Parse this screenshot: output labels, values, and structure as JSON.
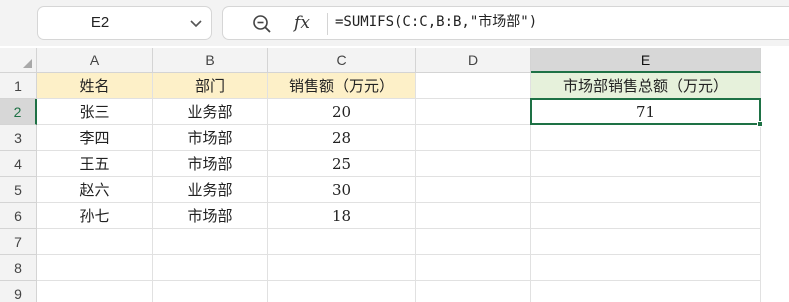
{
  "formula_bar": {
    "name_box": "E2",
    "formula": "=SUMIFS(C:C,B:B,\"市场部\")",
    "zoom_icon": "zoom-icon",
    "fx_label": "fx",
    "dropdown_icon": "chevron-down-icon"
  },
  "sheet": {
    "active_cell": "E2",
    "columns": [
      "A",
      "B",
      "C",
      "D",
      "E"
    ],
    "rows": [
      "1",
      "2",
      "3",
      "4",
      "5",
      "6",
      "7",
      "8",
      "9"
    ],
    "cells": {
      "A1": "姓名",
      "B1": "部门",
      "C1": "销售额（万元）",
      "E1": "市场部销售总额（万元）",
      "A2": "张三",
      "B2": "业务部",
      "C2": "20",
      "E2": "71",
      "A3": "李四",
      "B3": "市场部",
      "C3": "28",
      "A4": "王五",
      "B4": "市场部",
      "C4": "25",
      "A5": "赵六",
      "B5": "业务部",
      "C5": "30",
      "A6": "孙七",
      "B6": "市场部",
      "C6": "18"
    },
    "colors": {
      "header_fill_a_c": "#fdf0c8",
      "header_fill_e": "#e6f1db",
      "selection_accent": "#1e7145"
    }
  }
}
